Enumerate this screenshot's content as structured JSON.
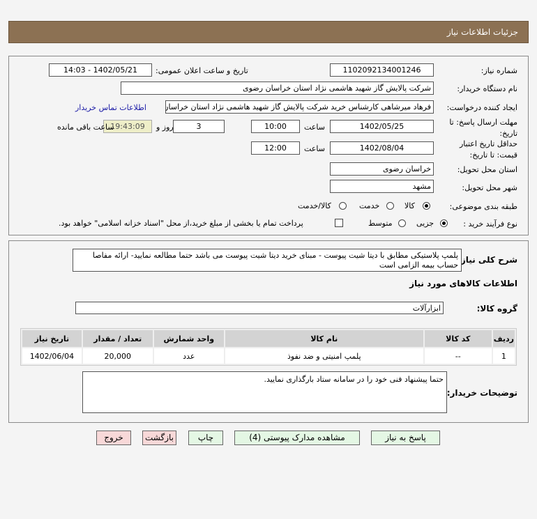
{
  "header": {
    "title": "جزئیات اطلاعات نیاز"
  },
  "form": {
    "need_number_label": "شماره نیاز:",
    "need_number": "1102092134001246",
    "announce_label": "تاریخ و ساعت اعلان عمومی:",
    "announce_value": "1402/05/21 - 14:03",
    "buyer_label": "نام دستگاه خریدار:",
    "buyer_value": "شرکت پالایش گاز شهید هاشمی نژاد   استان خراسان رضوی",
    "creator_label": "ایجاد کننده درخواست:",
    "creator_value": "فرهاد میرشاهی کارشناس خرید شرکت پالایش گاز شهید هاشمی نژاد   استان خراسان رضوی",
    "contact_link": "اطلاعات تماس خریدار",
    "deadline_label": "مهلت ارسال پاسخ: تا تاریخ:",
    "deadline_date": "1402/05/25",
    "time_label": "ساعت",
    "deadline_time": "10:00",
    "days": "3",
    "days_label": "روز و",
    "remaining": "19:43:09",
    "remaining_label": "ساعت باقی مانده",
    "validity_label": "حداقل تاریخ اعتبار قیمت: تا تاریخ:",
    "validity_date": "1402/08/04",
    "validity_time": "12:00",
    "province_label": "استان محل تحویل:",
    "province": "خراسان رضوی",
    "city_label": "شهر محل تحویل:",
    "city": "مشهد",
    "category_label": "طبقه بندی موضوعی:",
    "category_options": [
      "کالا",
      "خدمت",
      "کالا/خدمت"
    ],
    "category_selected": "کالا",
    "process_label": "نوع فرآیند خرید :",
    "process_options": [
      "جزیی",
      "متوسط"
    ],
    "process_selected": "جزیی",
    "payment_note": "پرداخت تمام یا بخشی از مبلغ خرید،از محل \"اسناد خزانه اسلامی\" خواهد بود."
  },
  "details": {
    "desc_label": "شرح کلی نیاز:",
    "desc": "پلمپ پلاستیکی مطابق با دیتا شیت پیوست - مبنای خرید دیتا شیت پیوست می باشد حتما مطالعه نمایید- ارائه مفاصا حساب بیمه الزامی است",
    "goods_title": "اطلاعات کالاهای مورد نیاز",
    "group_label": "گروه کالا:",
    "group": "ابزارآلات",
    "table": {
      "headers": [
        "ردیف",
        "کد کالا",
        "نام کالا",
        "واحد شمارش",
        "تعداد / مقدار",
        "تاریخ نیاز"
      ],
      "rows": [
        [
          "1",
          "--",
          "پلمپ امنیتی و ضد نفوذ",
          "عدد",
          "20,000",
          "1402/06/04"
        ]
      ]
    },
    "notes_label": "توضیحات خریدار:",
    "notes": "حتما پیشنهاد فنی خود را در سامانه ستاد بارگذاری نمایید."
  },
  "buttons": {
    "reply": "پاسخ به نیاز",
    "docs": "مشاهده مدارک پیوستی (4)",
    "print": "چاپ",
    "back": "بازگشت",
    "exit": "خروج"
  },
  "colors": {
    "header": "#8c7153",
    "remaining_bg": "#eeeec8",
    "link": "#1a1aa6"
  }
}
